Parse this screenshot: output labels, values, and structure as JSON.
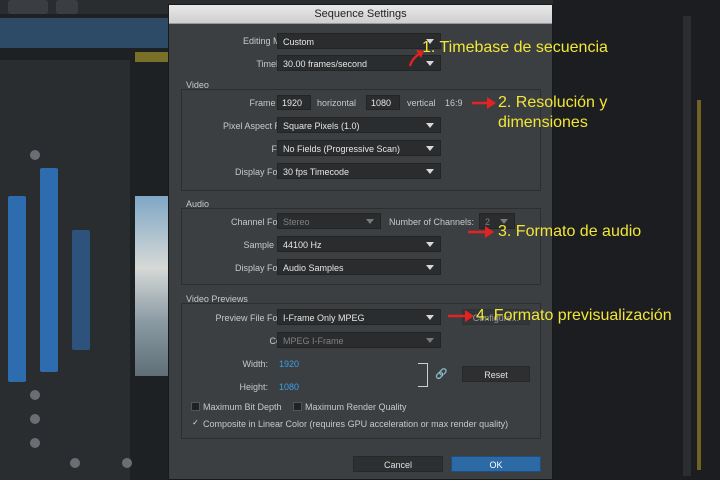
{
  "dialog": {
    "title": "Sequence Settings",
    "editing_mode": {
      "label": "Editing Mode:",
      "value": "Custom"
    },
    "timebase": {
      "label": "Timebase:",
      "value": "30.00  frames/second"
    },
    "video": {
      "title": "Video",
      "frame_size_label": "Frame Size:",
      "width": "1920",
      "horizontal_label": "horizontal",
      "height": "1080",
      "vertical_label": "vertical",
      "ratio": "16:9",
      "pixel_aspect": {
        "label": "Pixel Aspect Ratio:",
        "value": "Square Pixels (1.0)"
      },
      "fields": {
        "label": "Fields:",
        "value": "No Fields (Progressive Scan)"
      },
      "display_format": {
        "label": "Display Format:",
        "value": "30 fps Timecode"
      }
    },
    "audio": {
      "title": "Audio",
      "channel_format": {
        "label": "Channel Format:",
        "value": "Stereo"
      },
      "num_channels": {
        "label": "Number of Channels:",
        "value": "2"
      },
      "sample_rate": {
        "label": "Sample Rate:",
        "value": "44100 Hz"
      },
      "display_format": {
        "label": "Display Format:",
        "value": "Audio Samples"
      }
    },
    "previews": {
      "title": "Video Previews",
      "file_format": {
        "label": "Preview File Format:",
        "value": "I-Frame Only MPEG"
      },
      "config_label": "Configure...",
      "codec": {
        "label": "Codec:",
        "value": "MPEG I-Frame"
      },
      "width": {
        "label": "Width:",
        "value": "1920"
      },
      "height": {
        "label": "Height:",
        "value": "1080"
      },
      "reset_label": "Reset",
      "max_bit_depth": {
        "label": "Maximum Bit Depth",
        "checked": false
      },
      "max_render_quality": {
        "label": "Maximum Render Quality",
        "checked": false
      },
      "linear_color": {
        "label": "Composite in Linear Color (requires GPU acceleration or max render quality)",
        "checked": true,
        "mark": "✓"
      }
    },
    "cancel_label": "Cancel",
    "ok_label": "OK"
  },
  "annotations": {
    "a1": "1. Timebase de secuencia",
    "a2_line1": "2. Resolución y",
    "a2_line2": "dimensiones",
    "a3": "3. Formato de audio",
    "a4": "4. Formato previsualización"
  },
  "colors": {
    "annotation": "#f2e636",
    "arrow": "#e32222",
    "ok_button": "#2c6aa6"
  }
}
